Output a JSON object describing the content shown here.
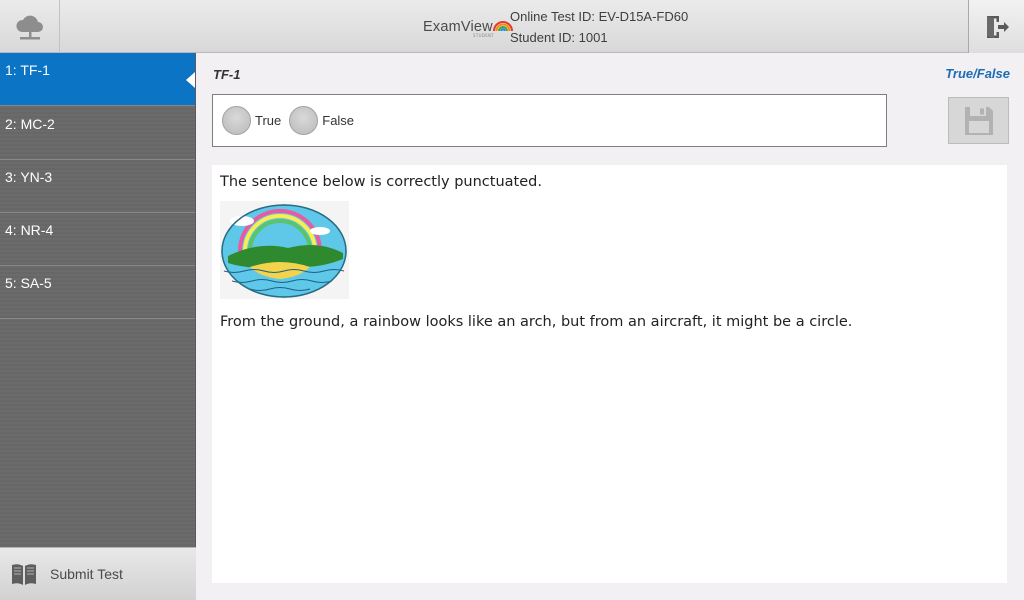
{
  "header": {
    "logo_word": "ExamView",
    "logo_sub": "STUDENT",
    "online_test_id": "Online Test ID: EV-D15A-FD60",
    "student_id": "Student ID: 1001"
  },
  "sidebar": {
    "items": [
      {
        "label": "1: TF-1",
        "active": true
      },
      {
        "label": "2: MC-2",
        "active": false
      },
      {
        "label": "3: YN-3",
        "active": false
      },
      {
        "label": "4: NR-4",
        "active": false
      },
      {
        "label": "5: SA-5",
        "active": false
      }
    ],
    "submit_label": "Submit Test"
  },
  "question": {
    "id": "TF-1",
    "type": "True/False",
    "options": [
      "True",
      "False"
    ],
    "stem": "The sentence below is correctly punctuated.",
    "statement": "From the ground, a rainbow looks like an arch, but from an aircraft, it might be a circle."
  },
  "colors": {
    "accent": "#0b74c5",
    "type_label": "#1b6db5"
  }
}
